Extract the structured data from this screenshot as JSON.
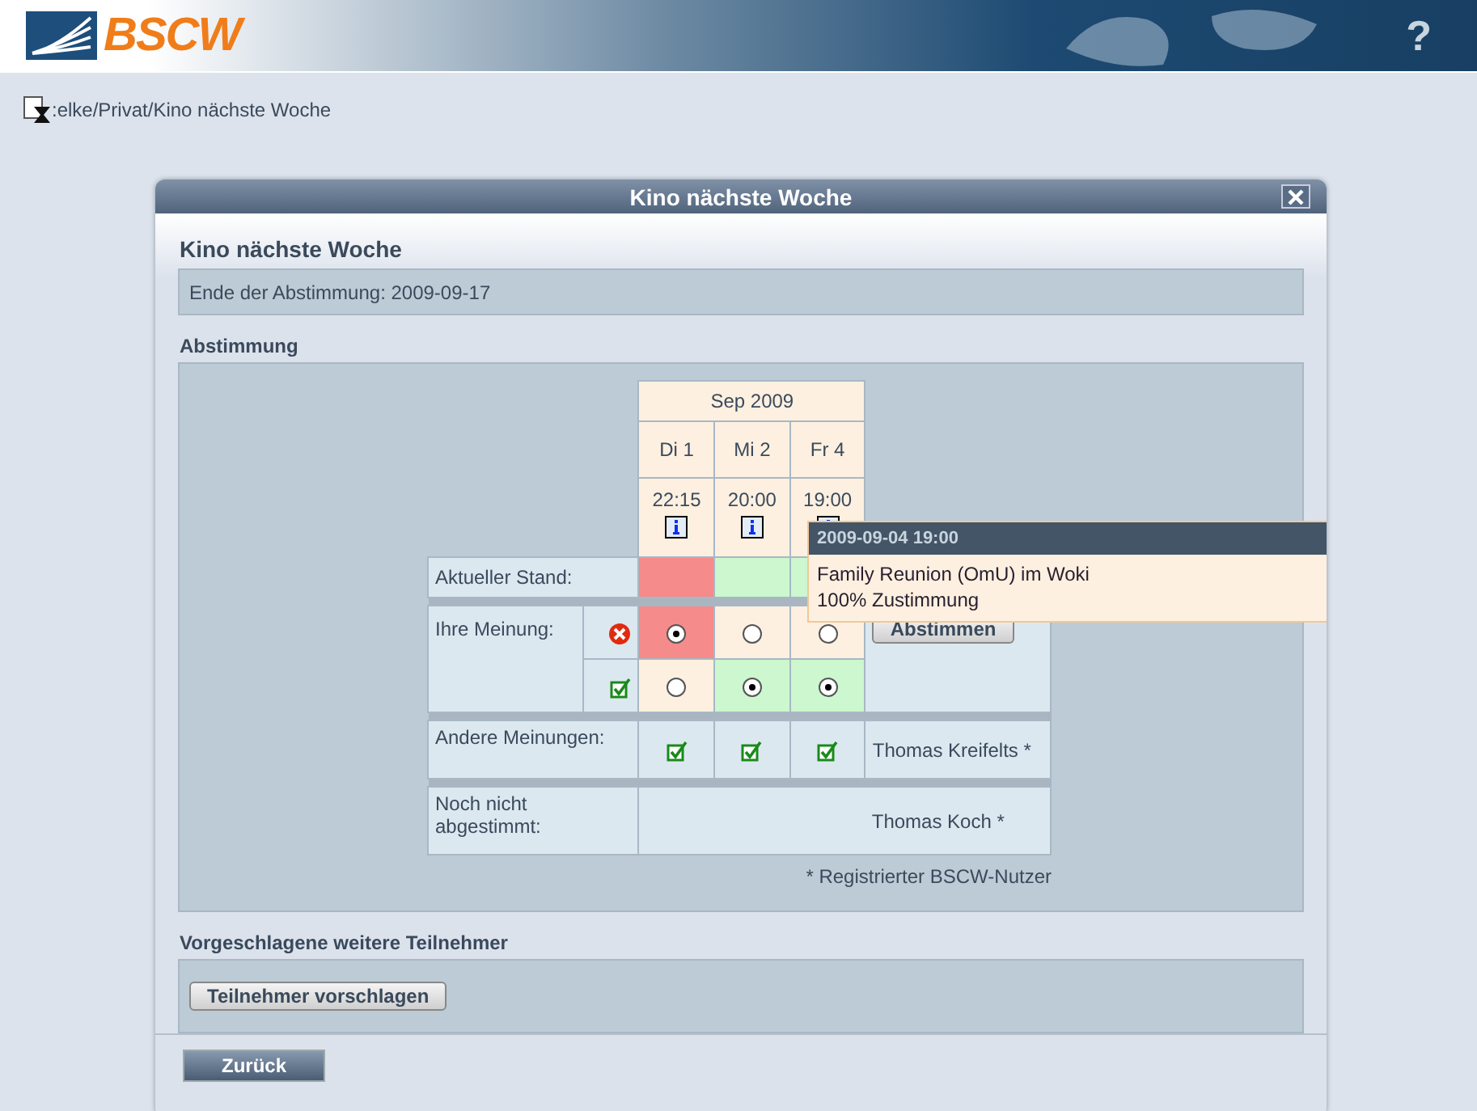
{
  "header": {
    "logo": "BSCW",
    "help": "?"
  },
  "breadcrumb": ":elke/Privat/Kino nächste Woche",
  "dialog": {
    "title": "Kino nächste Woche",
    "heading": "Kino nächste Woche",
    "deadline": "Ende der Abstimmung: 2009-09-17",
    "poll_title": "Abstimmung",
    "month": "Sep 2009",
    "options": [
      {
        "day": "Di 1",
        "time": "22:15",
        "approved": false,
        "reject_selected": true,
        "approve_selected": false,
        "other_approved": true
      },
      {
        "day": "Mi 2",
        "time": "20:00",
        "approved": true,
        "reject_selected": false,
        "approve_selected": true,
        "other_approved": true
      },
      {
        "day": "Fr 4",
        "time": "19:00",
        "approved": true,
        "reject_selected": false,
        "approve_selected": true,
        "other_approved": true
      }
    ],
    "current_label": "Aktueller Stand:",
    "my_label": "Ihre Meinung:",
    "vote_button": "Abstimmen",
    "others_label": "Andere Meinungen:",
    "other_user": "Thomas Kreifelts *",
    "pending_label": "Noch nicht abgestimmt:",
    "pending_user": "Thomas Koch *",
    "footnote": "* Registrierter BSCW-Nutzer",
    "suggest_title": "Vorgeschlagene weitere Teilnehmer",
    "suggest_button": "Teilnehmer vorschlagen",
    "back_button": "Zurück"
  },
  "tooltip": {
    "title": "2009-09-04 19:00",
    "lines": [
      "Family Reunion (OmU) im Woki",
      "100% Zustimmung"
    ]
  }
}
